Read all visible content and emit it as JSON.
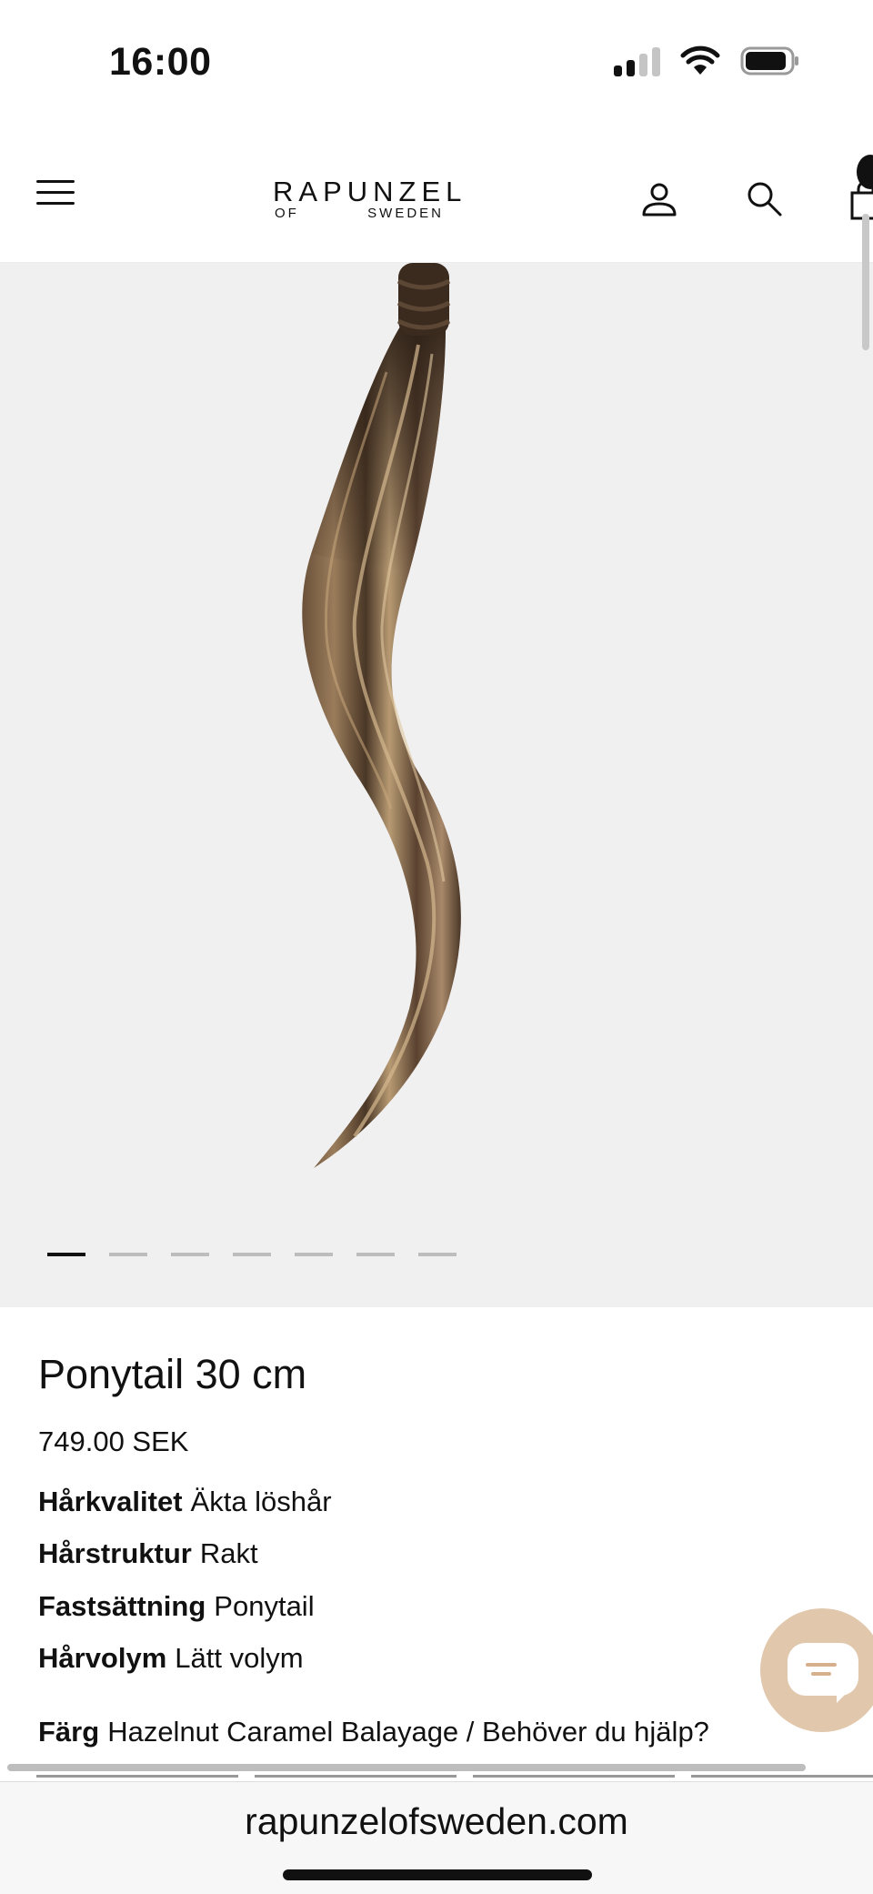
{
  "status_bar": {
    "time": "16:00",
    "icons": [
      "cellular-signal-icon",
      "wifi-icon",
      "battery-icon"
    ]
  },
  "header": {
    "logo": {
      "main": "RAPUNZEL",
      "sub_left": "OF",
      "sub_right": "SWEDEN"
    },
    "icons": [
      "hamburger-menu-icon",
      "account-icon",
      "search-icon",
      "cart-icon"
    ]
  },
  "gallery": {
    "slide_count": 7,
    "active_slide": 1
  },
  "product": {
    "title": "Ponytail 30 cm",
    "price": "749.00 SEK",
    "attributes": [
      {
        "label": "Hårkvalitet",
        "value": "Äkta löshår"
      },
      {
        "label": "Hårstruktur",
        "value": "Rakt"
      },
      {
        "label": "Fastsättning",
        "value": "Ponytail"
      },
      {
        "label": "Hårvolym",
        "value": "Lätt volym"
      }
    ],
    "color": {
      "label": "Färg",
      "value": "Hazelnut Caramel Balayage / Behöver du hjälp?"
    }
  },
  "chat": {
    "icon": "chat-bubble-icon",
    "color": "#e1c7ac"
  },
  "browser": {
    "url": "rapunzelofsweden.com"
  },
  "colors": {
    "gallery_background": "#f1f0f0",
    "text": "#111111"
  }
}
